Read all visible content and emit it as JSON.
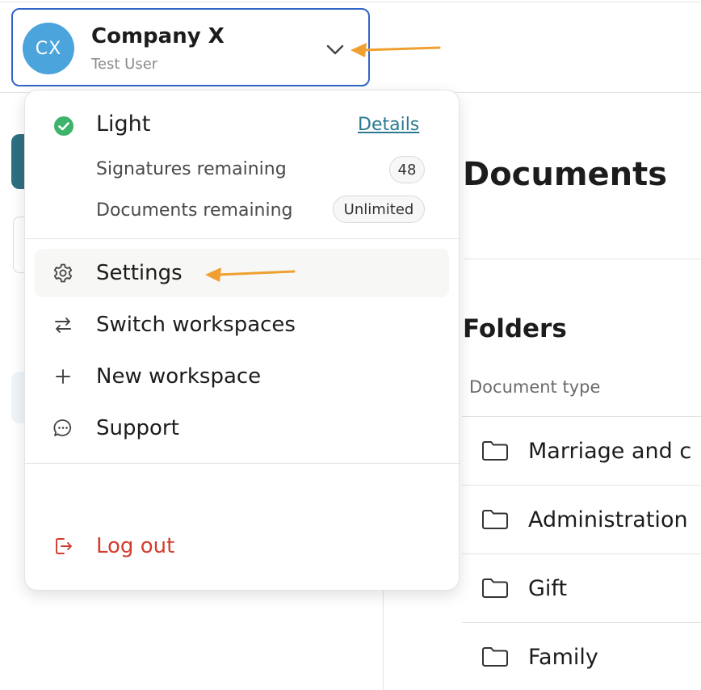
{
  "workspace": {
    "avatar_initials": "CX",
    "company_name": "Company X",
    "user_name": "Test User",
    "avatar_color": "#4ca4dc",
    "border_color": "#3264c8"
  },
  "dropdown": {
    "plan": {
      "name": "Light",
      "details_label": "Details",
      "signatures_label": "Signatures remaining",
      "signatures_value": "48",
      "documents_label": "Documents remaining",
      "documents_value": "Unlimited"
    },
    "menu": {
      "settings": "Settings",
      "switch_workspaces": "Switch workspaces",
      "new_workspace": "New workspace",
      "support": "Support",
      "log_out": "Log out"
    }
  },
  "page": {
    "title": "Documents",
    "folders_title": "Folders",
    "column_header": "Document type",
    "folders": [
      "Marriage and c",
      "Administration",
      "Gift",
      "Family"
    ]
  },
  "colors": {
    "accent_link": "#2a7a92",
    "danger": "#d23c2e",
    "success": "#3db36b",
    "annotation_arrow": "#f0a030"
  },
  "icons": {
    "check": "check-circle-icon",
    "settings": "gear-icon",
    "switch": "swap-arrows-icon",
    "new": "plus-icon",
    "support": "chat-bubble-icon",
    "logout": "logout-icon",
    "chevron": "chevron-down-icon",
    "folder": "folder-icon"
  }
}
